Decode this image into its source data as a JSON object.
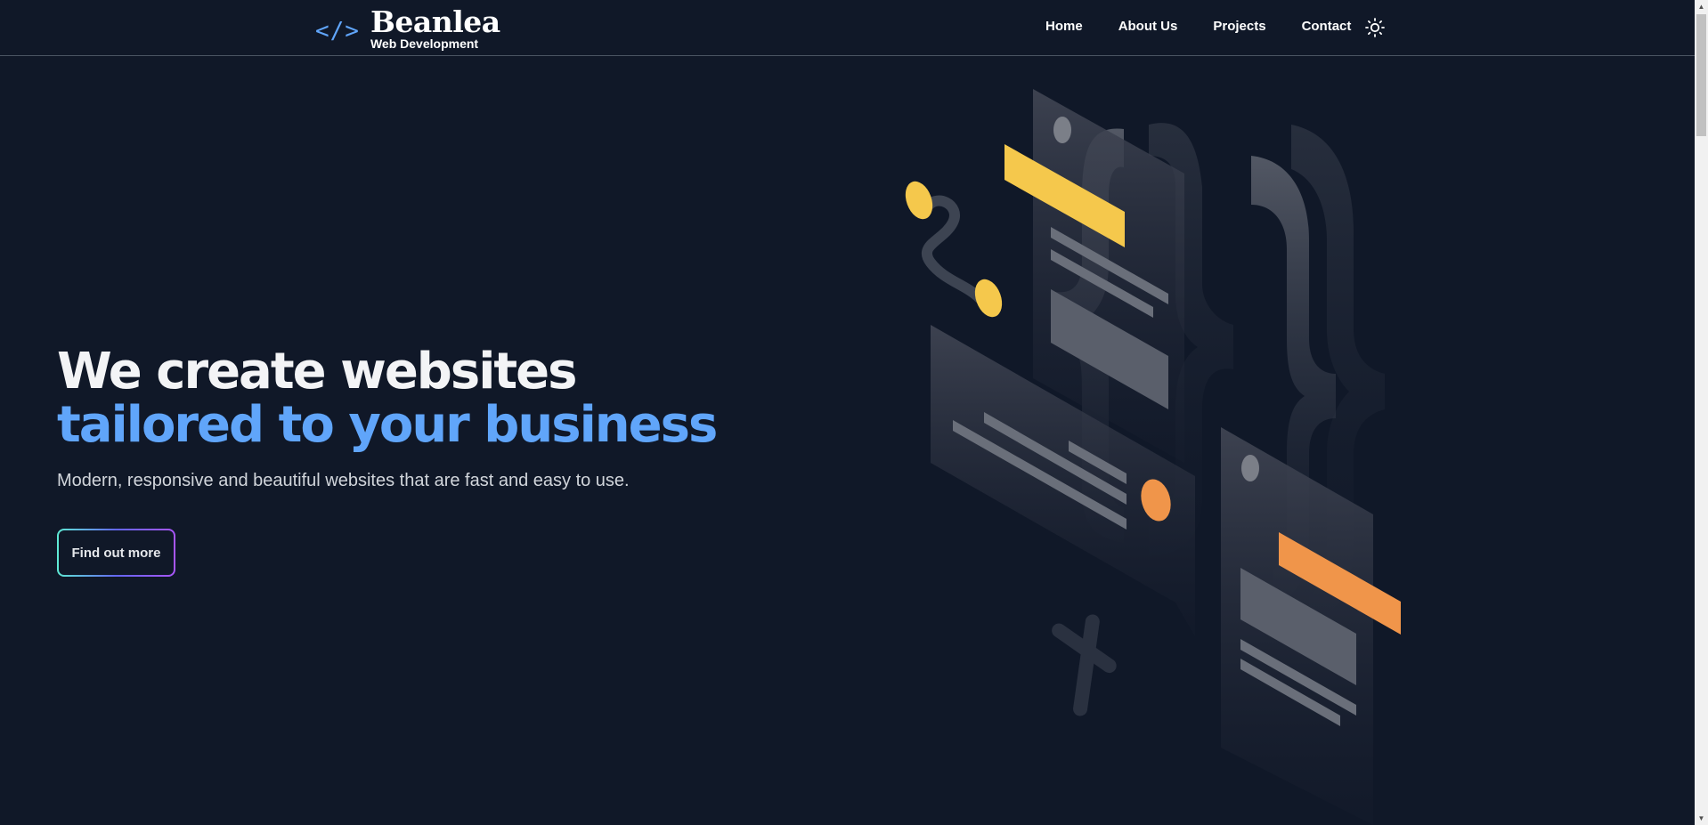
{
  "brand": {
    "icon": "code-icon",
    "icon_text": "</>",
    "name": "Beanlea",
    "subtitle": "Web Development"
  },
  "nav": {
    "items": [
      "Home",
      "About Us",
      "Projects",
      "Contact"
    ],
    "theme_icon": "sun-icon"
  },
  "hero": {
    "title_line1": "We create websites",
    "title_line2": "tailored to your business",
    "subtitle": "Modern, responsive and beautiful websites that are fast and easy to use.",
    "cta_label": "Find out more"
  },
  "colors": {
    "background": "#101828",
    "accent_blue": "#60a5fa",
    "yellow": "#f5c84c",
    "orange": "#f0954a"
  }
}
